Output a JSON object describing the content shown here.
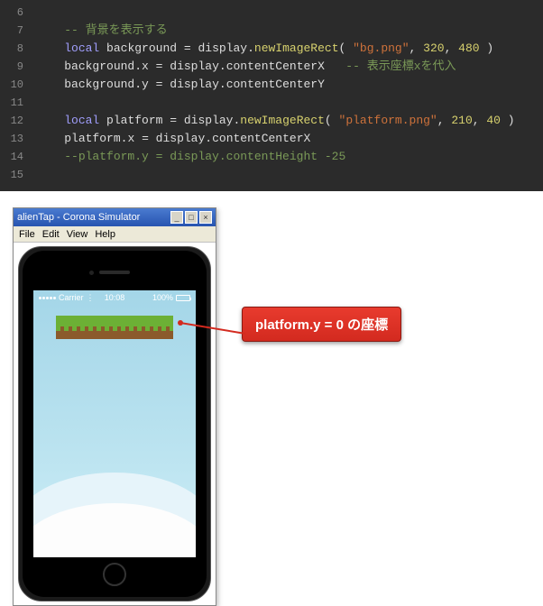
{
  "code": {
    "lines": [
      {
        "n": "6",
        "tokens": []
      },
      {
        "n": "7",
        "tokens": [
          {
            "c": "t-comment",
            "t": "-- 背景を表示する"
          }
        ]
      },
      {
        "n": "8",
        "tokens": [
          {
            "c": "t-keyword",
            "t": "local"
          },
          {
            "c": "t-ident",
            "t": " background "
          },
          {
            "c": "t-punc",
            "t": "= "
          },
          {
            "c": "t-ident",
            "t": "display"
          },
          {
            "c": "t-punc",
            "t": "."
          },
          {
            "c": "t-fname",
            "t": "newImageRect"
          },
          {
            "c": "t-punc",
            "t": "( "
          },
          {
            "c": "t-string",
            "t": "\"bg.png\""
          },
          {
            "c": "t-punc",
            "t": ", "
          },
          {
            "c": "t-number",
            "t": "320"
          },
          {
            "c": "t-punc",
            "t": ", "
          },
          {
            "c": "t-number",
            "t": "480"
          },
          {
            "c": "t-punc",
            "t": " )"
          }
        ]
      },
      {
        "n": "9",
        "tokens": [
          {
            "c": "t-ident",
            "t": "background"
          },
          {
            "c": "t-punc",
            "t": "."
          },
          {
            "c": "t-ident",
            "t": "x"
          },
          {
            "c": "t-punc",
            "t": " = "
          },
          {
            "c": "t-ident",
            "t": "display"
          },
          {
            "c": "t-punc",
            "t": "."
          },
          {
            "c": "t-ident",
            "t": "contentCenterX"
          },
          {
            "c": "t-comment",
            "t": "   -- 表示座標xを代入"
          }
        ]
      },
      {
        "n": "10",
        "tokens": [
          {
            "c": "t-ident",
            "t": "background"
          },
          {
            "c": "t-punc",
            "t": "."
          },
          {
            "c": "t-ident",
            "t": "y"
          },
          {
            "c": "t-punc",
            "t": " = "
          },
          {
            "c": "t-ident",
            "t": "display"
          },
          {
            "c": "t-punc",
            "t": "."
          },
          {
            "c": "t-ident",
            "t": "contentCenterY"
          }
        ]
      },
      {
        "n": "11",
        "tokens": []
      },
      {
        "n": "12",
        "tokens": [
          {
            "c": "t-keyword",
            "t": "local"
          },
          {
            "c": "t-ident",
            "t": " platform "
          },
          {
            "c": "t-punc",
            "t": "= "
          },
          {
            "c": "t-ident",
            "t": "display"
          },
          {
            "c": "t-punc",
            "t": "."
          },
          {
            "c": "t-fname",
            "t": "newImageRect"
          },
          {
            "c": "t-punc",
            "t": "( "
          },
          {
            "c": "t-string",
            "t": "\"platform.png\""
          },
          {
            "c": "t-punc",
            "t": ", "
          },
          {
            "c": "t-number",
            "t": "210"
          },
          {
            "c": "t-punc",
            "t": ", "
          },
          {
            "c": "t-number",
            "t": "40"
          },
          {
            "c": "t-punc",
            "t": " )"
          }
        ]
      },
      {
        "n": "13",
        "tokens": [
          {
            "c": "t-ident",
            "t": "platform"
          },
          {
            "c": "t-punc",
            "t": "."
          },
          {
            "c": "t-ident",
            "t": "x"
          },
          {
            "c": "t-punc",
            "t": " = "
          },
          {
            "c": "t-ident",
            "t": "display"
          },
          {
            "c": "t-punc",
            "t": "."
          },
          {
            "c": "t-ident",
            "t": "contentCenterX"
          }
        ]
      },
      {
        "n": "14",
        "tokens": [
          {
            "c": "t-comment",
            "t": "--platform.y = display.contentHeight -25"
          }
        ]
      },
      {
        "n": "15",
        "tokens": []
      }
    ]
  },
  "simulator": {
    "title": "alienTap - Corona Simulator",
    "menu": [
      "File",
      "Edit",
      "View",
      "Help"
    ],
    "status": {
      "carrier": "Carrier",
      "time": "10:08",
      "battery": "100%"
    }
  },
  "callout": {
    "label": "platform.y = 0 の座標"
  }
}
